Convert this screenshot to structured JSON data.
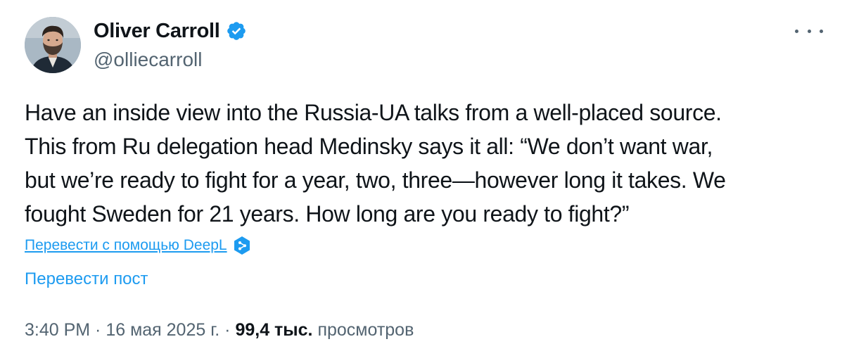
{
  "author": {
    "display_name": "Oliver Carroll",
    "handle": "@olliecarroll",
    "verified": true,
    "verified_color": "#1d9bf0"
  },
  "more_icon": "ellipsis-horizontal-icon",
  "tweet": {
    "lines": [
      "Have an inside view into the Russia-UA talks from a well-placed source.",
      "This from Ru delegation head Medinsky says it all: “We don’t want war,",
      "but we’re ready to fight for a year, two, three—however long it takes. We",
      "fought Sweden for 21 years. How long are you ready to fight?”"
    ]
  },
  "translate": {
    "deepl_label": "Перевести с помощью DeepL",
    "deepl_icon": "deepl-icon",
    "post_label": "Перевести пост"
  },
  "meta": {
    "time": "3:40 PM",
    "separator1": " · ",
    "date": "16 мая 2025 г.",
    "separator2": " · ",
    "views_count": "99,4 тыс.",
    "views_label": " просмотров"
  },
  "colors": {
    "link": "#1d9bf0",
    "secondary_text": "#536471",
    "primary_text": "#0f1419"
  }
}
